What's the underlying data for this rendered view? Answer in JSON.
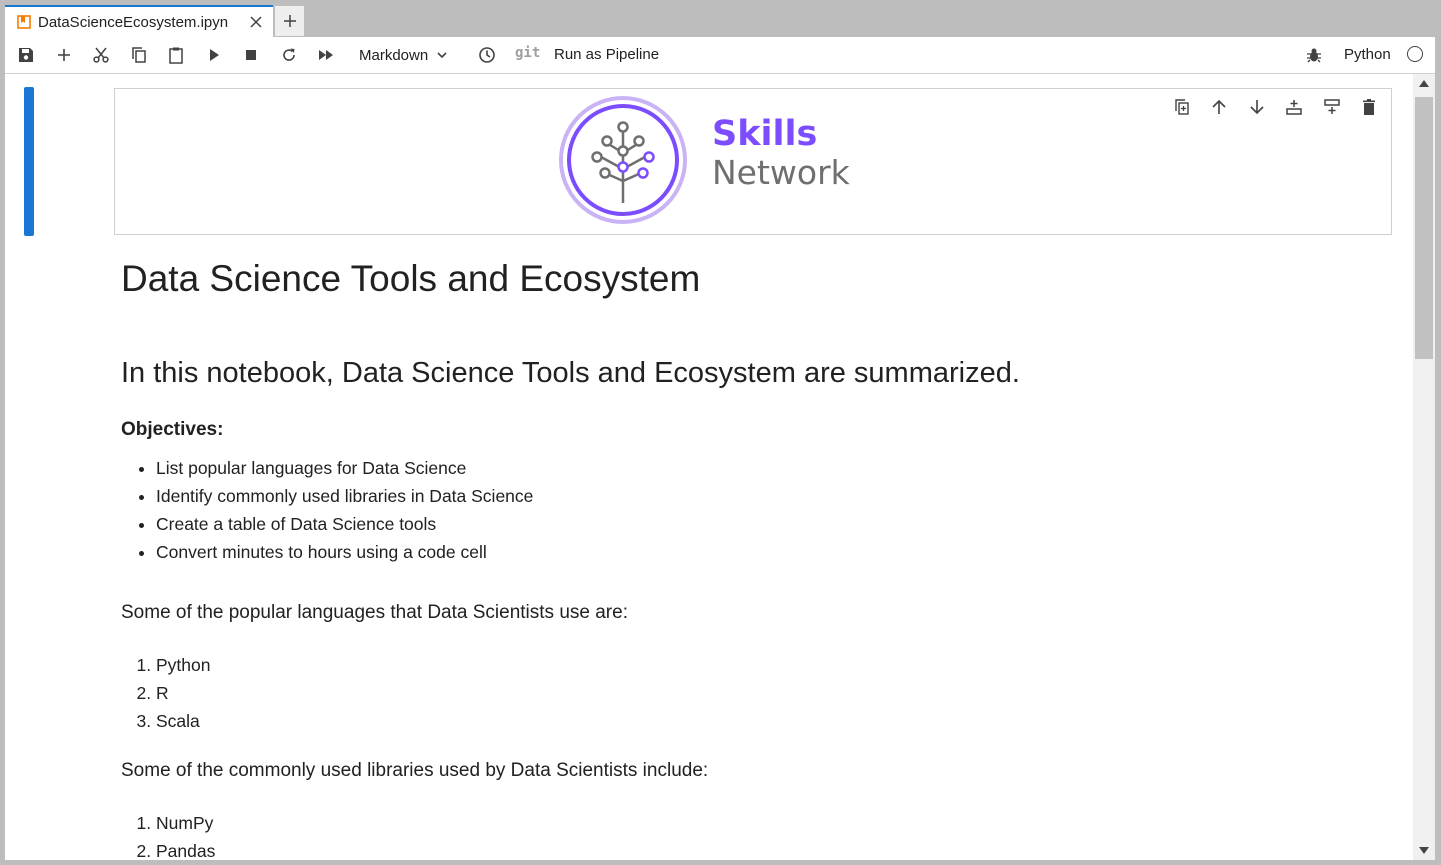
{
  "tab": {
    "title": "DataScienceEcosystem.ipyn",
    "icon": "notebook-icon",
    "accent": "#1976d2"
  },
  "toolbar": {
    "cell_type": "Markdown",
    "git_label": "git",
    "pipeline_label": "Run as Pipeline",
    "kernel_name": "Python"
  },
  "logo": {
    "line1": "Skills",
    "line2": "Network",
    "color_primary": "#7c4dff",
    "color_secondary": "#6f6f6f"
  },
  "notebook": {
    "title": "Data Science Tools and Ecosystem",
    "subtitle": "In this notebook, Data Science Tools and Ecosystem are summarized.",
    "objectives_label": "Objectives:",
    "objectives": [
      "List popular languages for Data Science",
      "Identify commonly used libraries in Data Science",
      "Create a table of Data Science tools",
      "Convert minutes to hours using a code cell"
    ],
    "languages_intro": "Some of the popular languages that Data Scientists use are:",
    "languages": [
      "Python",
      "R",
      "Scala"
    ],
    "libraries_intro": "Some of the commonly used libraries used by Data Scientists include:",
    "libraries": [
      "NumPy",
      "Pandas"
    ]
  }
}
